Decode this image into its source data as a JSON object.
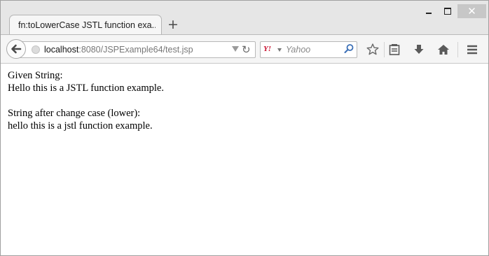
{
  "window": {
    "close_glyph": "✕"
  },
  "tab": {
    "title": "fn:toLowerCase JSTL function exa...",
    "new_tab_glyph": "+"
  },
  "address_bar": {
    "host": "localhost",
    "path": ":8080/JSPExample64/test.jsp"
  },
  "search_bar": {
    "engine_icon": "yahoo-logo-icon",
    "engine_glyph": "Y!",
    "placeholder": "Yahoo"
  },
  "toolbar": {
    "icons": [
      "bookmark-star-icon",
      "reading-list-icon",
      "download-icon",
      "home-icon",
      "menu-icon"
    ]
  },
  "page": {
    "line1": "Given String:",
    "line2": "Hello this is a JSTL function example.",
    "line3": "String after change case (lower):",
    "line4": "hello this is a jstl function example."
  },
  "colors": {
    "close_button": "#c7c7c7",
    "tab_background": "#f6f6f6",
    "toolbar_background": "#f5f5f5",
    "content_background": "#ffffff"
  }
}
